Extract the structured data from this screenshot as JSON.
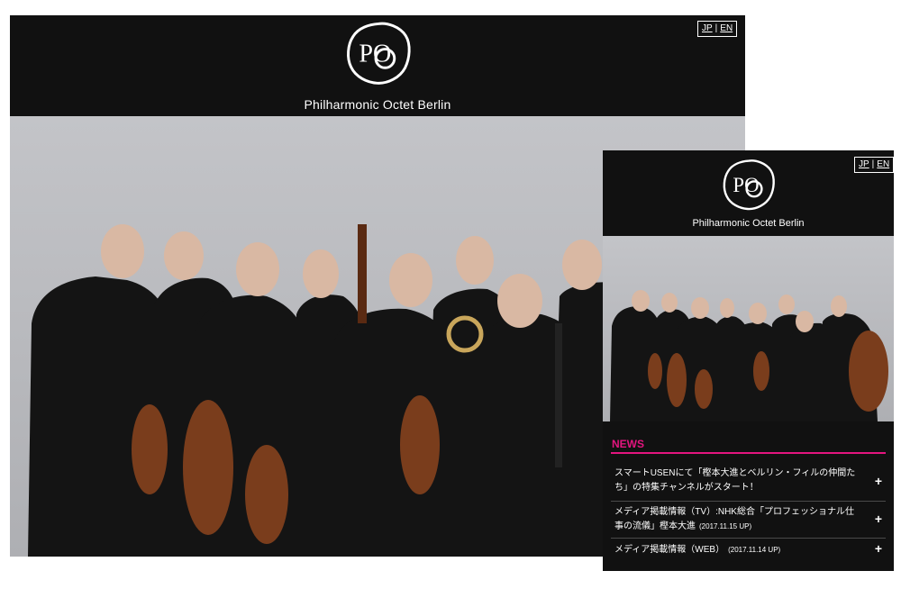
{
  "brand": {
    "name": "Philharmonic Octet Berlin",
    "logo_letters": "PO"
  },
  "lang": {
    "jp": "JP",
    "separator": "|",
    "en": "EN"
  },
  "colors": {
    "header_bg": "#111111",
    "accent": "#e4157f",
    "text": "#ffffff"
  },
  "icons": {
    "logo": "po-monogram-icon",
    "expand": "plus-icon"
  },
  "hero": {
    "subject": "group-photo-eight-musicians-with-instruments"
  },
  "news": {
    "heading": "NEWS",
    "items": [
      {
        "text": "スマートUSENにて「樫本大進とベルリン・フィルの仲間たち」の特集チャンネルがスタート！",
        "date": "",
        "expand": "+"
      },
      {
        "text": "メディア掲載情報（TV）:NHK総合「プロフェッショナル仕事の流儀」樫本大進",
        "date": "(2017.11.15 UP)",
        "expand": "+"
      },
      {
        "text": "メディア掲載情報（WEB）",
        "date": "(2017.11.14 UP)",
        "expand": "+"
      }
    ]
  }
}
